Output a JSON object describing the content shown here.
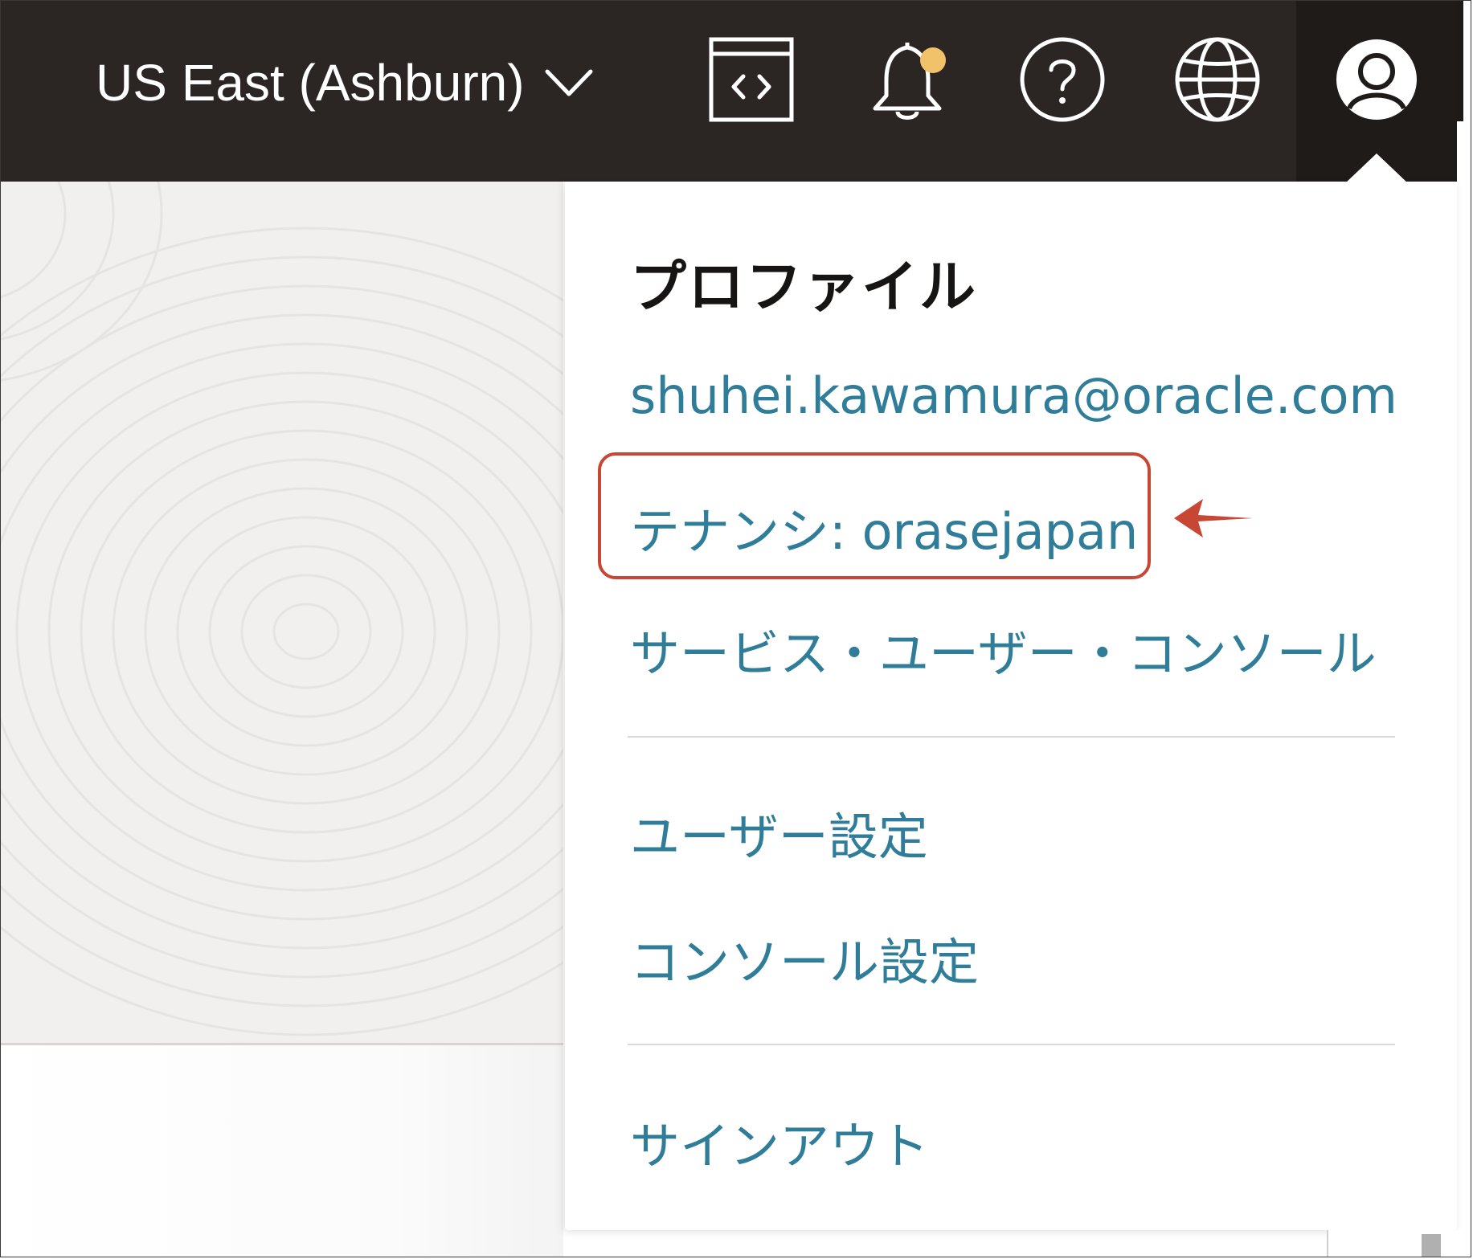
{
  "header": {
    "region_label": "US East (Ashburn)",
    "icons": [
      "code-editor-icon",
      "bell-icon",
      "help-icon",
      "globe-icon",
      "user-avatar-icon"
    ],
    "notification_dot_color": "#f2c26b",
    "background_color": "#2b2624"
  },
  "profile_menu": {
    "title": "プロファイル",
    "email": "shuhei.kawamura@oracle.com",
    "tenancy": "テナンシ: orasejapan",
    "service_user_console": "サービス・ユーザー・コンソール",
    "user_settings": "ユーザー設定",
    "console_settings": "コンソール設定",
    "sign_out": "サインアウト",
    "link_color": "#2f7d99"
  },
  "annotation": {
    "highlight_color": "#c74634"
  }
}
